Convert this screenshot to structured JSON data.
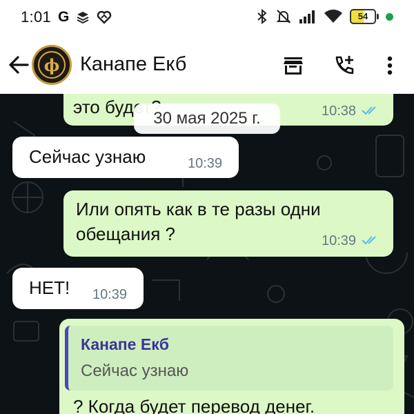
{
  "status_bar": {
    "time": "1:01",
    "google_icon": "G",
    "battery_level": "54",
    "icons": [
      "google-icon",
      "layers-icon",
      "heart-icon",
      "bluetooth-icon",
      "mute-icon",
      "signal-icon",
      "wifi-icon",
      "battery-icon",
      "dot-icon"
    ]
  },
  "header": {
    "title": "Канапе Екб",
    "icons": [
      "back-arrow-icon",
      "store-icon",
      "add-call-icon",
      "more-vert-icon"
    ]
  },
  "chat": {
    "date_chip": "30 мая 2025 г.",
    "messages": [
      {
        "direction": "out",
        "text": "это будет?",
        "time": "10:38",
        "read": true
      },
      {
        "direction": "in",
        "text": "Сейчас узнаю",
        "time": "10:39"
      },
      {
        "direction": "out",
        "text_line1": "Или опять как в те разы одни",
        "text_line2": "обещания ?",
        "time": "10:39",
        "read": true
      },
      {
        "direction": "in",
        "text": "НЕТ!",
        "time": "10:39"
      },
      {
        "direction": "out",
        "quote_sender": "Канапе Екб",
        "quote_text": "Сейчас узнаю",
        "text": "? Когда будет перевод денег."
      }
    ]
  },
  "colors": {
    "outgoing_bubble": "#dcf8c6",
    "incoming_bubble": "#ffffff",
    "chat_background": "#0c1215",
    "read_ticks": "#53bdeb",
    "quote_accent": "#4b47b8"
  }
}
